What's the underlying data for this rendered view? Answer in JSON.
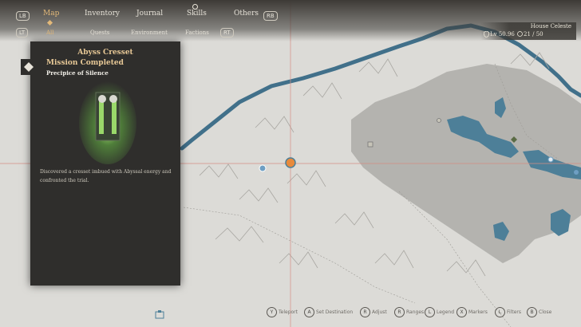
{
  "nav": {
    "left_bumper": "LB",
    "right_bumper": "RB",
    "left_trigger": "LT",
    "right_trigger": "RT",
    "tabs": [
      {
        "label": "Map",
        "active": true
      },
      {
        "label": "Inventory",
        "active": false
      },
      {
        "label": "Journal",
        "active": false
      },
      {
        "label": "Skills",
        "active": false
      },
      {
        "label": "Others",
        "active": false
      }
    ],
    "subtabs": [
      {
        "label": "All",
        "active": true
      },
      {
        "label": "Quests",
        "active": false
      },
      {
        "label": "Environment",
        "active": false
      },
      {
        "label": "Factions",
        "active": false
      }
    ]
  },
  "player": {
    "location": "House Celeste",
    "level": "Lv 50.96",
    "points": "21 / 50"
  },
  "panel": {
    "title": "Abyss Cresset",
    "status": "Mission Completed",
    "location": "Precipice of Silence",
    "description": "Discovered a cresset imbued with Abyssal energy and confronted the trial."
  },
  "hints": [
    {
      "key": "Y",
      "label": "Teleport"
    },
    {
      "key": "A",
      "label": "Set Destination"
    },
    {
      "key": "R",
      "label": "Adjust"
    },
    {
      "key": "R",
      "label": "Ranges"
    },
    {
      "key": "L",
      "label": "Legend"
    },
    {
      "key": "X",
      "label": "Markers"
    },
    {
      "key": "L",
      "label": "Filters"
    },
    {
      "key": "B",
      "label": "Close"
    }
  ],
  "colors": {
    "accent": "#e3b979",
    "water": "#3f6f88",
    "highlight": "#e88a3c"
  }
}
